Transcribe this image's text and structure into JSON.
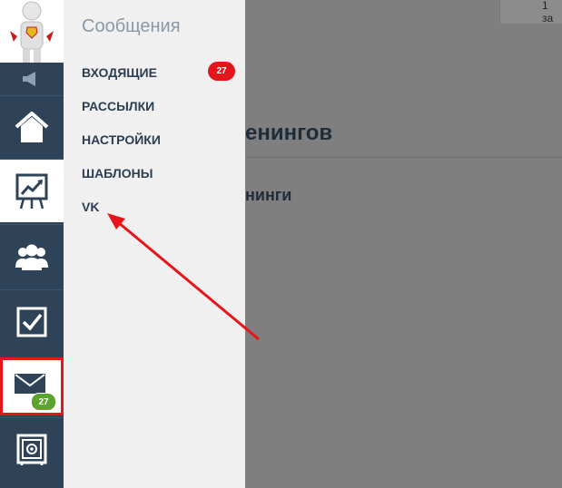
{
  "menu": {
    "title": "Сообщения",
    "items": [
      {
        "label": "ВХОДЯЩИЕ",
        "badge": "27"
      },
      {
        "label": "РАССЫЛКИ"
      },
      {
        "label": "НАСТРОЙКИ"
      },
      {
        "label": "ШАБЛОНЫ"
      },
      {
        "label": "VK"
      }
    ]
  },
  "sidebar": {
    "items": [
      {
        "icon": "speaker-icon"
      },
      {
        "icon": "home-icon"
      },
      {
        "icon": "chart-board-icon"
      },
      {
        "icon": "users-group-icon"
      },
      {
        "icon": "checkbox-icon"
      },
      {
        "icon": "envelope-icon",
        "badge": "27"
      },
      {
        "icon": "safe-icon"
      }
    ]
  },
  "main": {
    "title_fragment": "енингов",
    "subtitle_fragment": "нинги",
    "corner_text": "1 за"
  },
  "colors": {
    "rail": "#2f4358",
    "menu_bg": "#f0f0f0",
    "overlay": "#7f7f7f",
    "badge_red": "#e3161e",
    "badge_green": "#5aa52e",
    "highlight": "#e8141b"
  }
}
